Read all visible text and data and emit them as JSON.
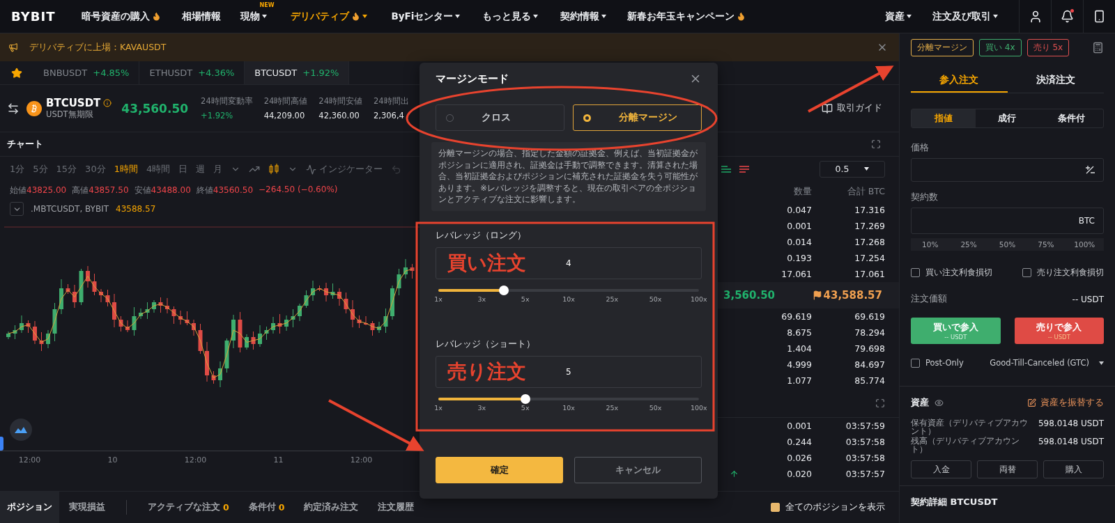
{
  "nav": {
    "logo": "BYBIT",
    "items": [
      {
        "label": "暗号資産の購入",
        "flame": true,
        "caret": false,
        "selected": false
      },
      {
        "label": "相場情報",
        "flame": false,
        "caret": false,
        "selected": false
      },
      {
        "label": "現物",
        "flame": false,
        "caret": true,
        "badge": "NEW",
        "selected": false
      },
      {
        "label": "デリバティブ",
        "flame": true,
        "caret": true,
        "selected": true
      },
      {
        "label": "ByFiセンター",
        "flame": false,
        "caret": true,
        "selected": false
      },
      {
        "label": "もっと見る",
        "flame": false,
        "caret": true,
        "selected": false
      },
      {
        "label": "契約情報",
        "flame": false,
        "caret": true,
        "selected": false
      },
      {
        "label": "新春お年玉キャンペーン",
        "flame": true,
        "caret": false,
        "selected": false
      }
    ],
    "right_items": [
      {
        "label": "資産"
      },
      {
        "label": "注文及び取引"
      }
    ],
    "notification_dot": true
  },
  "announcement": "デリバティブに上場：KAVAUSDT",
  "tickers": [
    {
      "symbol": "BNBUSDT",
      "change": "+4.85%",
      "selected": false
    },
    {
      "symbol": "ETHUSDT",
      "change": "+4.36%",
      "selected": false
    },
    {
      "symbol": "BTCUSDT",
      "change": "+1.92%",
      "selected": true
    }
  ],
  "symbol": {
    "name": "BTCUSDT",
    "sub": "USDT無期限",
    "price": "43,560.50",
    "stats": [
      {
        "label": "24時間変動率",
        "value": "+1.92%",
        "kind": "up"
      },
      {
        "label": "24時間高値",
        "value": "44,209.00",
        "kind": "plain"
      },
      {
        "label": "24時間安値",
        "value": "42,360.00",
        "kind": "plain"
      },
      {
        "label": "24時間出",
        "value": "2,306,4",
        "kind": "plain"
      }
    ],
    "guide": "取引ガイド"
  },
  "chart": {
    "title": "チャート",
    "intervals": [
      {
        "label": "1分",
        "selected": false
      },
      {
        "label": "5分",
        "selected": false
      },
      {
        "label": "15分",
        "selected": false
      },
      {
        "label": "30分",
        "selected": false
      },
      {
        "label": "1時間",
        "selected": true
      },
      {
        "label": "4時間",
        "selected": false
      },
      {
        "label": "日",
        "selected": false
      },
      {
        "label": "週",
        "selected": false
      },
      {
        "label": "月",
        "selected": false
      }
    ],
    "indicator": "インジケーター",
    "ohlc": {
      "items": [
        {
          "label": "始値",
          "value": "43825.00"
        },
        {
          "label": "高値",
          "value": "43857.50"
        },
        {
          "label": "安値",
          "value": "43488.00"
        },
        {
          "label": "終値",
          "value": "43560.50"
        }
      ],
      "change": "−264.50 (−0.60%)"
    },
    "index": {
      "name": ".MBTCUSDT, BYBIT",
      "value": "43588.57"
    },
    "xaxis": [
      "12:00",
      "10",
      "12:00",
      "11",
      "12:00"
    ]
  },
  "orderbook": {
    "step": "0.5",
    "columns": [
      "数量",
      "合計 BTC"
    ],
    "asks": [
      {
        "qty": "0.047",
        "total": "17.316"
      },
      {
        "qty": "0.001",
        "total": "17.269"
      },
      {
        "qty": "0.014",
        "total": "17.268"
      },
      {
        "qty": "0.193",
        "total": "17.254"
      },
      {
        "qty": "17.061",
        "total": "17.061"
      }
    ],
    "last": "3,560.50",
    "mark": "43,588.57",
    "bids": [
      {
        "qty": "69.619",
        "total": "69.619"
      },
      {
        "qty": "8.675",
        "total": "78.294"
      },
      {
        "qty": "1.404",
        "total": "79.698"
      },
      {
        "qty": "4.999",
        "total": "84.697"
      },
      {
        "qty": "1.077",
        "total": "85.774"
      }
    ],
    "trades": [
      {
        "qty": "0.001",
        "time": "03:57:59",
        "up": false
      },
      {
        "qty": "0.244",
        "time": "03:57:58",
        "up": false
      },
      {
        "qty": "0.026",
        "time": "03:57:58",
        "up": false
      },
      {
        "qty": "0.020",
        "time": "03:57:57",
        "up": true
      }
    ]
  },
  "bottom_tabs": [
    {
      "label": "ポジション",
      "selected": true
    },
    {
      "label": "実現損益",
      "selected": false
    },
    {
      "label": "アクティブな注文",
      "count": "0",
      "selected": false
    },
    {
      "label": "条件付",
      "count": "0",
      "selected": false
    },
    {
      "label": "約定済み注文",
      "selected": false
    },
    {
      "label": "注文履歴",
      "selected": false
    }
  ],
  "show_all": {
    "label": "全てのポジションを表示",
    "checked": true
  },
  "order_panel": {
    "tags": [
      {
        "label": "分離マージン",
        "kind": "mode"
      },
      {
        "label": "買い 4x",
        "kind": "buy"
      },
      {
        "label": "売り 5x",
        "kind": "sell"
      }
    ],
    "tabs": [
      {
        "label": "参入注文",
        "selected": true
      },
      {
        "label": "決済注文",
        "selected": false
      }
    ],
    "order_types": [
      {
        "label": "指値",
        "selected": true
      },
      {
        "label": "成行",
        "selected": false
      },
      {
        "label": "条件付",
        "selected": false
      }
    ],
    "price_label": "価格",
    "qty_label": "契約数",
    "qty_unit": "BTC",
    "percents": [
      "10%",
      "25%",
      "50%",
      "75%",
      "100%"
    ],
    "tpsl": [
      {
        "label": "買い注文利食損切",
        "checked": false
      },
      {
        "label": "売り注文利食損切",
        "checked": false
      }
    ],
    "order_value": {
      "label": "注文価額",
      "value": "-- USDT"
    },
    "actions": [
      {
        "label": "買いで参入",
        "sub": "-- USDT",
        "kind": "buy"
      },
      {
        "label": "売りで参入",
        "sub": "-- USDT",
        "kind": "sell"
      }
    ],
    "post_only": {
      "label": "Post-Only",
      "checked": false
    },
    "tif": "Good-Till-Canceled (GTC)",
    "assets": {
      "title": "資産",
      "transfer": "資産を振替する",
      "rows": [
        {
          "label": "保有資産（デリバティブアカウント）",
          "value": "598.0148 USDT"
        },
        {
          "label": "残高（デリバティブアカウント）",
          "value": "598.0148 USDT"
        }
      ],
      "buttons": [
        "入金",
        "両替",
        "購入"
      ]
    },
    "contract_title": "契約詳細 BTCUSDT"
  },
  "modal": {
    "title": "マージンモード",
    "options": [
      {
        "label": "クロス",
        "selected": false
      },
      {
        "label": "分離マージン",
        "selected": true
      }
    ],
    "description": "分離マージンの場合、指定した金額の証拠金、例えば、当初証拠金がポジションに適用され、証拠金は手動で調整できます。清算された場合、当初証拠金およびポジションに補充された証拠金を失う可能性があります。※レバレッジを調整すると、現在の取引ペアの全ポジションとアクティブな注文に影響します。",
    "leverages": [
      {
        "label": "レバレッジ（ロング）",
        "value": "4",
        "annotation": "買い注文",
        "level": 0.25,
        "ticks": [
          "1x",
          "3x",
          "5x",
          "10x",
          "25x",
          "50x",
          "100x"
        ]
      },
      {
        "label": "レバレッジ（ショート）",
        "value": "5",
        "annotation": "売り注文",
        "level": 0.333,
        "ticks": [
          "1x",
          "3x",
          "5x",
          "10x",
          "25x",
          "50x",
          "100x"
        ]
      }
    ],
    "confirm": "確定",
    "cancel": "キャンセル"
  }
}
